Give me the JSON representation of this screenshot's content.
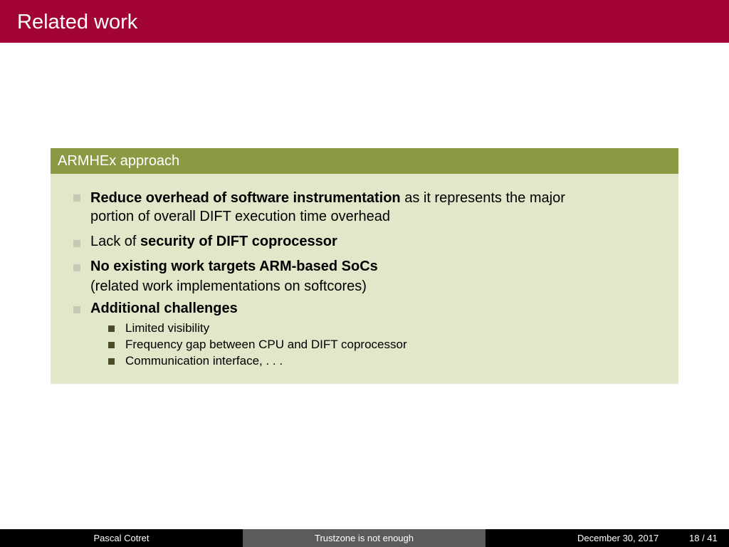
{
  "slide": {
    "title": "Related work"
  },
  "block": {
    "title": "ARMHEx approach",
    "items": [
      {
        "bold": "Reduce overhead of software instrumentation",
        "rest": " as it represents the major",
        "line2": "portion of overall DIFT execution time overhead"
      },
      {
        "prefix": "Lack of ",
        "bold": "security of DIFT coprocessor"
      },
      {
        "bold": "No existing work targets ARM-based SoCs",
        "line2": "(related work implementations on softcores)"
      },
      {
        "bold": "Additional challenges",
        "subitems": [
          "Limited visibility",
          "Frequency gap between CPU and DIFT coprocessor",
          "Communication interface, . . ."
        ]
      }
    ]
  },
  "footer": {
    "author": "Pascal Cotret",
    "short_title": "Trustzone is not enough",
    "date": "December 30, 2017",
    "page": "18 / 41"
  },
  "colors": {
    "title_bar": "#a20535",
    "block_header": "#8a9a43",
    "block_body": "#e1e8c9",
    "footer_dark": "#000000",
    "footer_mid": "#5b5b5b"
  }
}
